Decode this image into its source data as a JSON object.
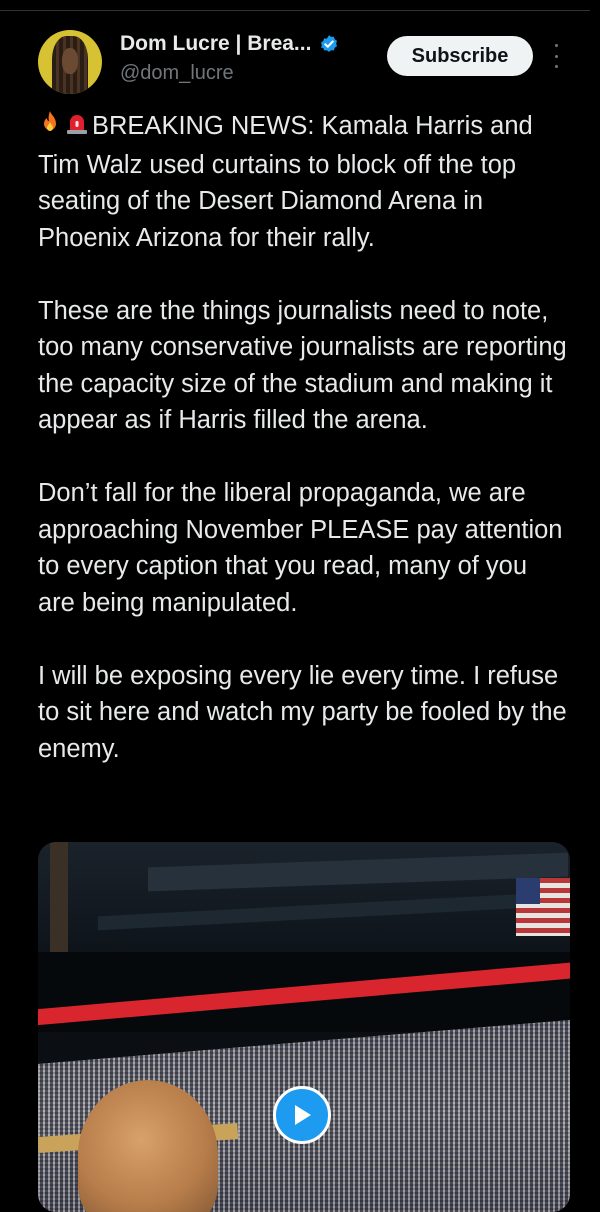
{
  "author": {
    "display_name": "Dom Lucre | Brea...",
    "handle": "@dom_lucre",
    "verified_icon": "verified-badge-icon",
    "avatar_icon": "avatar"
  },
  "actions": {
    "subscribe_label": "Subscribe",
    "more_icon": "more-vertical-icon"
  },
  "tweet": {
    "emojis": [
      "fire-icon",
      "siren-icon"
    ],
    "paragraphs": [
      "BREAKING NEWS: Kamala Harris and Tim Walz used curtains to block off the top seating of the Desert Diamond Arena in Phoenix Arizona for their rally.",
      "These are the things journalists need to note, too many conservative journalists are reporting the capacity size of the stadium and making it appear as if Harris filled the arena.",
      "Don’t fall for the liberal propaganda, we are approaching November PLEASE pay attention to every caption that you read, many of you are being manipulated.",
      "I will be exposing every lie every time. I refuse to sit here and watch my party be fooled by the enemy."
    ]
  },
  "media": {
    "type": "video",
    "play_icon": "play-icon"
  },
  "colors": {
    "background": "#000000",
    "text": "#e7e9ea",
    "secondary_text": "#71767b",
    "accent": "#1d9bf0",
    "subscribe_bg": "#eff3f4"
  }
}
